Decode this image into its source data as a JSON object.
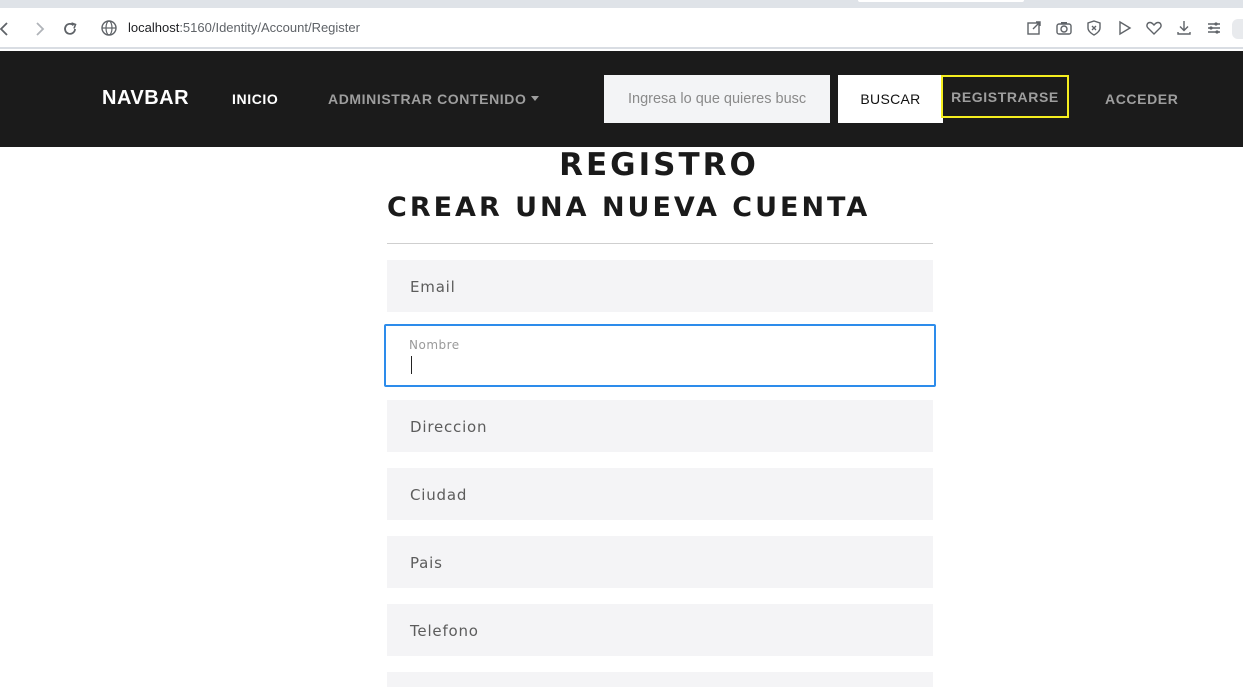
{
  "browser": {
    "url_host": "localhost",
    "url_path": ":5160/Identity/Account/Register",
    "icons": [
      "back-icon",
      "forward-icon",
      "reload-icon",
      "site-info-icon",
      "share-icon",
      "camera-icon",
      "shield-icon",
      "play-icon",
      "heart-icon",
      "download-icon",
      "menu-icon"
    ]
  },
  "navbar": {
    "brand": "NAVBAR",
    "links": {
      "inicio": "INICIO",
      "admin": "ADMINISTRAR CONTENIDO",
      "register": "REGISTRARSE",
      "login": "ACCEDER"
    },
    "search": {
      "placeholder": "Ingresa lo que quieres buscar",
      "button": "BUSCAR"
    },
    "highlight_color": "#f5ee1f"
  },
  "page": {
    "title": "REGISTRO",
    "subtitle": "CREAR UNA NUEVA CUENTA"
  },
  "form": {
    "email": "Email",
    "nombre_label": "Nombre",
    "direccion": "Direccion",
    "ciudad": "Ciudad",
    "pais": "Pais",
    "telefono": "Telefono",
    "focus_color": "#2d8ceb"
  }
}
